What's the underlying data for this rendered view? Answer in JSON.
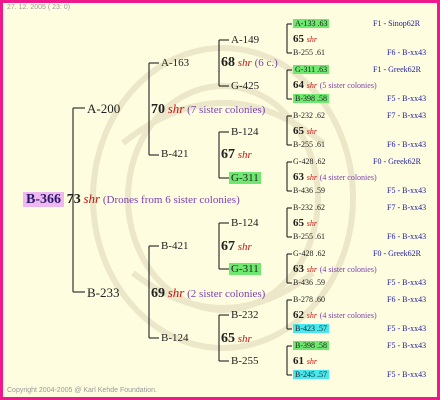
{
  "header": "27. 12. 2005 ( 23: 0)",
  "footer": "Copyright 2004-2005 @ Karl Kehde Foundation.",
  "root": {
    "name": "B-366",
    "num": "73",
    "shr": "shr",
    "note": "(Drones from 6 sister colonies)"
  },
  "g1": [
    {
      "name": "A-200",
      "num": "70",
      "shr": "shr",
      "note": "(7 sister colonies)"
    },
    {
      "name": "B-233",
      "num": "69",
      "shr": "shr",
      "note": "(2 sister colonies)"
    }
  ],
  "g2": [
    {
      "name": "A-163",
      "num": "68",
      "shr": "shr",
      "note": "(6 c.)"
    },
    {
      "name": "B-421",
      "num": "67",
      "shr": "shr",
      "note": ""
    },
    {
      "name": "B-421",
      "num": "67",
      "shr": "shr",
      "note": ""
    },
    {
      "name": "B-124",
      "num": "65",
      "shr": "shr",
      "note": ""
    }
  ],
  "g3": [
    {
      "name": "A-149",
      "num": "65",
      "shr": "shr",
      "note": ""
    },
    {
      "name": "G-425",
      "num": "64",
      "shr": "shr",
      "note": "(5 sister colonies)"
    },
    {
      "name": "B-124",
      "num": "65",
      "shr": "shr",
      "note": ""
    },
    {
      "name": "G-311",
      "num": "63",
      "shr": "shr",
      "note": "(4 sister colonies)"
    },
    {
      "name": "B-124",
      "num": "65",
      "shr": "shr",
      "note": ""
    },
    {
      "name": "G-311",
      "num": "63",
      "shr": "shr",
      "note": "(4 sister colonies)"
    },
    {
      "name": "B-232",
      "num": "62",
      "shr": "shr",
      "note": "(4 sister colonies)"
    },
    {
      "name": "B-255",
      "num": "61",
      "shr": "shr",
      "note": ""
    }
  ],
  "g4": [
    {
      "name": "A-133 .63",
      "origin": "F1 - Sinop62R"
    },
    {
      "name": "B-255 .61",
      "origin": "F6 - B-xx43"
    },
    {
      "name": "G-311 .63",
      "origin": "F1 - Greek62R"
    },
    {
      "name": "B-398 .58",
      "origin": "F5 - B-xx43"
    },
    {
      "name": "B-232 .62",
      "origin": "F7 - B-xx43"
    },
    {
      "name": "B-255 .61",
      "origin": "F6 - B-xx43"
    },
    {
      "name": "G-428 .62",
      "origin": "F0 - Greek62R"
    },
    {
      "name": "B-436 .59",
      "origin": "F5 - B-xx43"
    },
    {
      "name": "B-232 .62",
      "origin": "F7 - B-xx43"
    },
    {
      "name": "B-255 .61",
      "origin": "F6 - B-xx43"
    },
    {
      "name": "G-428 .62",
      "origin": "F0 - Greek62R"
    },
    {
      "name": "B-436 .59",
      "origin": "F5 - B-xx43"
    },
    {
      "name": "B-278 .60",
      "origin": "F6 - B-xx43"
    },
    {
      "name": "B-423 .57",
      "origin": "F5 - B-xx43"
    },
    {
      "name": "B-398 .58",
      "origin": "F5 - B-xx43"
    },
    {
      "name": "B-245 .57",
      "origin": "F5 - B-xx43"
    }
  ]
}
